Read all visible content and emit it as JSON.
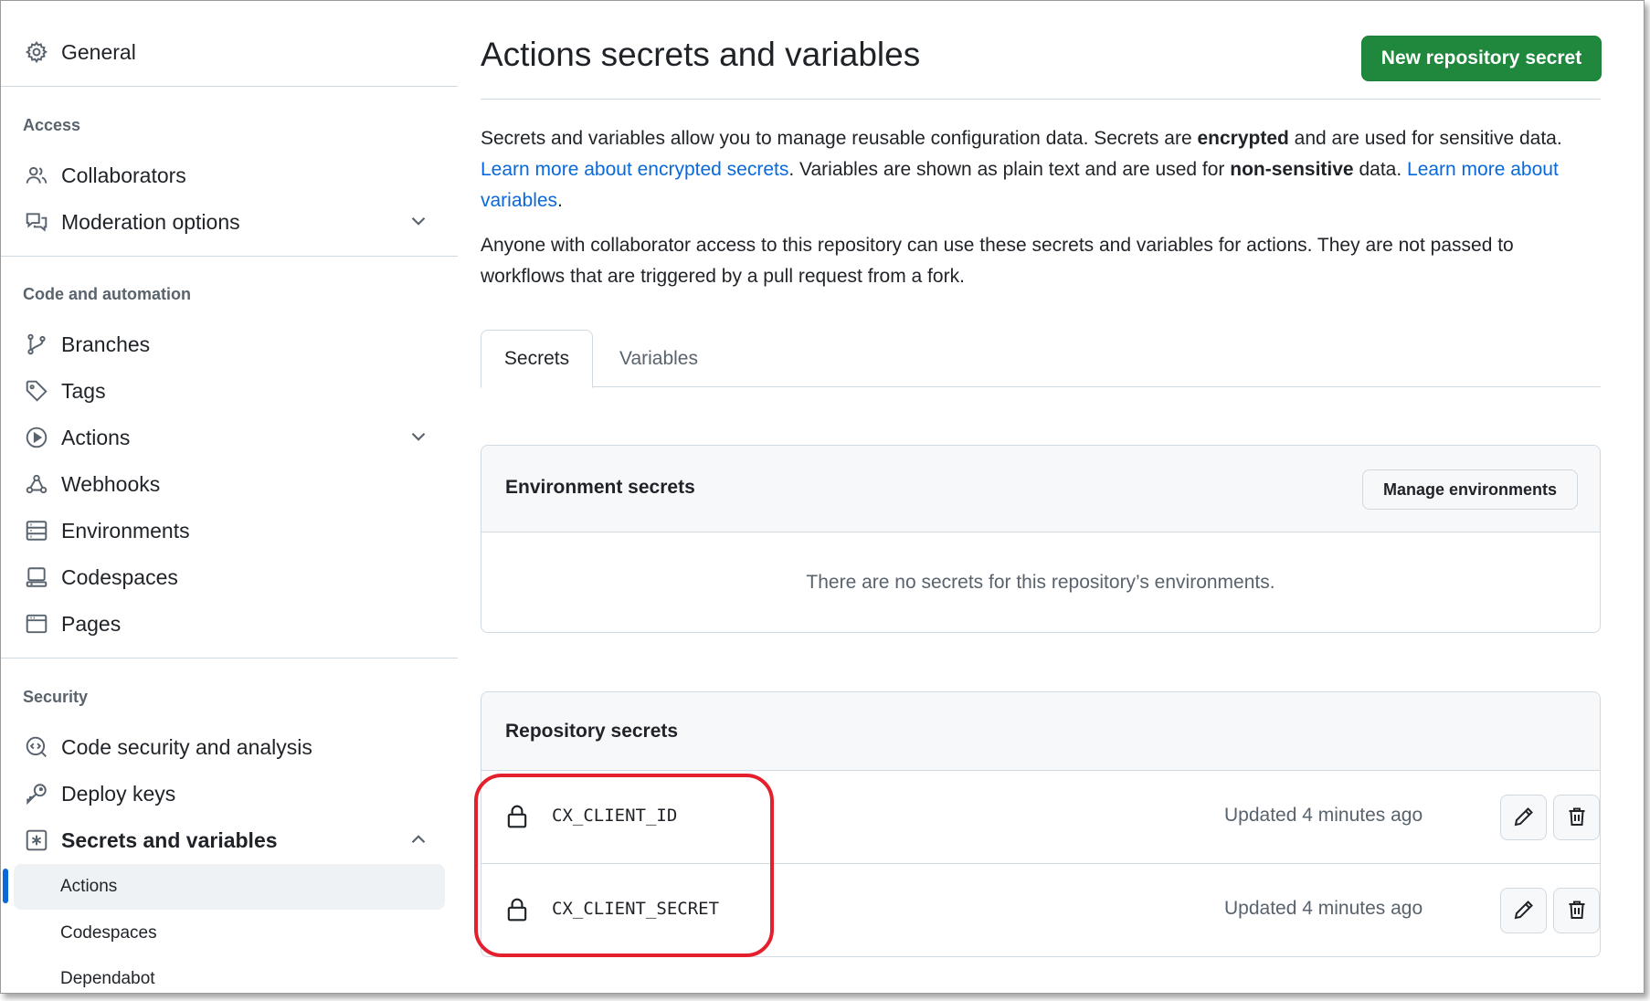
{
  "sidebar": {
    "general": "General",
    "access_label": "Access",
    "collaborators": "Collaborators",
    "moderation": "Moderation options",
    "code_label": "Code and automation",
    "branches": "Branches",
    "tags": "Tags",
    "actions": "Actions",
    "webhooks": "Webhooks",
    "environments": "Environments",
    "codespaces": "Codespaces",
    "pages": "Pages",
    "security_label": "Security",
    "code_security": "Code security and analysis",
    "deploy_keys": "Deploy keys",
    "secrets_vars": "Secrets and variables",
    "sub_actions": "Actions",
    "sub_codespaces": "Codespaces",
    "sub_dependabot": "Dependabot"
  },
  "main": {
    "title": "Actions secrets and variables",
    "new_secret_button": "New repository secret",
    "intro": {
      "p1_a": "Secrets and variables allow you to manage reusable configuration data. Secrets are ",
      "p1_b": "encrypted",
      "p1_c": " and are used for sensitive data. ",
      "p1_link1": "Learn more about encrypted secrets",
      "p1_d": ". Variables are shown as plain text and are used for ",
      "p1_e": "non-sensitive",
      "p1_f": " data. ",
      "p1_link2": "Learn more about variables",
      "p1_g": ".",
      "p2": "Anyone with collaborator access to this repository can use these secrets and variables for actions. They are not passed to workflows that are triggered by a pull request from a fork."
    },
    "tabs": [
      "Secrets",
      "Variables"
    ],
    "env_box": {
      "title": "Environment secrets",
      "manage_button": "Manage environments",
      "empty": "There are no secrets for this repository’s environments."
    },
    "repo_box": {
      "title": "Repository secrets",
      "rows": [
        {
          "name": "CX_CLIENT_ID",
          "updated": "Updated 4 minutes ago"
        },
        {
          "name": "CX_CLIENT_SECRET",
          "updated": "Updated 4 minutes ago"
        }
      ]
    }
  },
  "colors": {
    "primary_green": "#1f883d",
    "link_blue": "#0969da",
    "highlight_red": "#e3202c",
    "active_bar": "#0969da"
  }
}
